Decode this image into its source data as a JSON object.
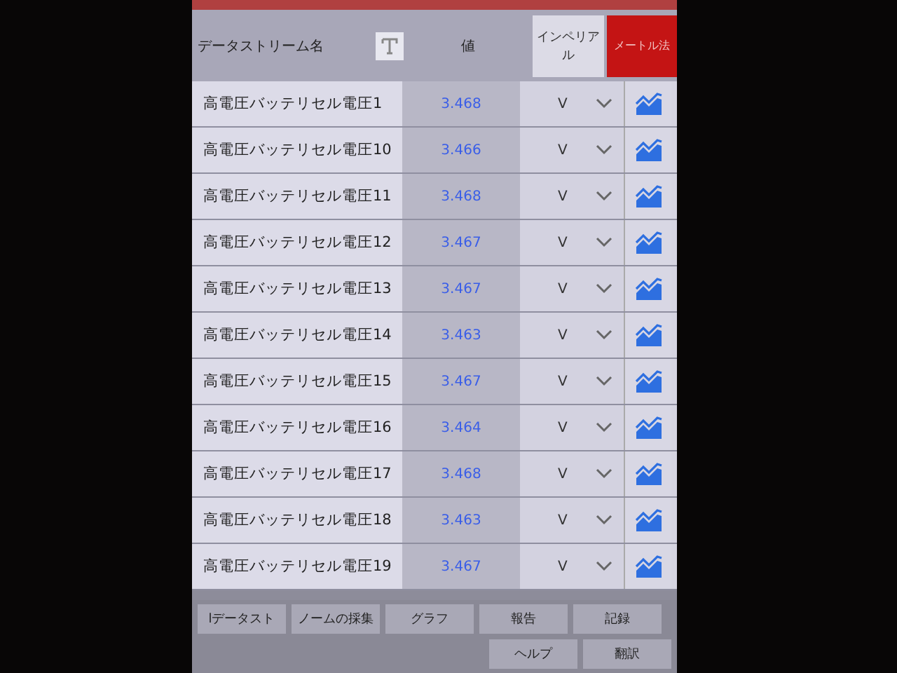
{
  "header": {
    "name_column": "データストリーム名",
    "value_column": "値",
    "unit_toggle": [
      {
        "label": "インペリアル",
        "selected": false
      },
      {
        "label": "メートル法",
        "selected": true
      }
    ]
  },
  "rows": [
    {
      "name": "高電圧バッテリセル電圧1",
      "value": "3.468",
      "unit": "V"
    },
    {
      "name": "高電圧バッテリセル電圧10",
      "value": "3.466",
      "unit": "V"
    },
    {
      "name": "高電圧バッテリセル電圧11",
      "value": "3.468",
      "unit": "V"
    },
    {
      "name": "高電圧バッテリセル電圧12",
      "value": "3.467",
      "unit": "V"
    },
    {
      "name": "高電圧バッテリセル電圧13",
      "value": "3.467",
      "unit": "V"
    },
    {
      "name": "高電圧バッテリセル電圧14",
      "value": "3.463",
      "unit": "V"
    },
    {
      "name": "高電圧バッテリセル電圧15",
      "value": "3.467",
      "unit": "V"
    },
    {
      "name": "高電圧バッテリセル電圧16",
      "value": "3.464",
      "unit": "V"
    },
    {
      "name": "高電圧バッテリセル電圧17",
      "value": "3.468",
      "unit": "V"
    },
    {
      "name": "高電圧バッテリセル電圧18",
      "value": "3.463",
      "unit": "V"
    },
    {
      "name": "高電圧バッテリセル電圧19",
      "value": "3.467",
      "unit": "V"
    }
  ],
  "buttons": [
    [
      "lデータスト",
      "ノームの採集",
      "グラフ",
      "報告",
      "記録"
    ],
    [
      "ヘルプ",
      "翻訳"
    ]
  ]
}
